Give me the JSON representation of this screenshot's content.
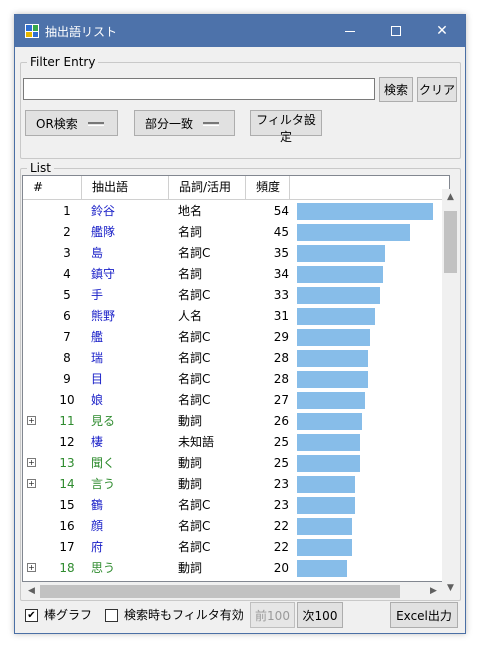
{
  "window": {
    "title": "抽出語リスト",
    "minimize": "—",
    "maximize": "□",
    "close": "✕"
  },
  "filter": {
    "legend": "Filter Entry",
    "search_value": "",
    "search_button": "検索",
    "clear_button": "クリア",
    "search_mode": "OR検索",
    "match_mode": "部分一致",
    "filter_settings": "フィルタ設定"
  },
  "list": {
    "legend": "List",
    "columns": [
      "#",
      "抽出語",
      "品詞/活用",
      "頻度"
    ],
    "max_freq": 54,
    "rows": [
      {
        "num": "1",
        "word": "鈴谷",
        "pos": "地名",
        "freq": 54,
        "expandable": false
      },
      {
        "num": "2",
        "word": "艦隊",
        "pos": "名詞",
        "freq": 45,
        "expandable": false
      },
      {
        "num": "3",
        "word": "島",
        "pos": "名詞C",
        "freq": 35,
        "expandable": false
      },
      {
        "num": "4",
        "word": "鎮守",
        "pos": "名詞",
        "freq": 34,
        "expandable": false
      },
      {
        "num": "5",
        "word": "手",
        "pos": "名詞C",
        "freq": 33,
        "expandable": false
      },
      {
        "num": "6",
        "word": "熊野",
        "pos": "人名",
        "freq": 31,
        "expandable": false
      },
      {
        "num": "7",
        "word": "艦",
        "pos": "名詞C",
        "freq": 29,
        "expandable": false
      },
      {
        "num": "8",
        "word": "瑞",
        "pos": "名詞C",
        "freq": 28,
        "expandable": false
      },
      {
        "num": "9",
        "word": "目",
        "pos": "名詞C",
        "freq": 28,
        "expandable": false
      },
      {
        "num": "10",
        "word": "娘",
        "pos": "名詞C",
        "freq": 27,
        "expandable": false
      },
      {
        "num": "11",
        "word": "見る",
        "pos": "動詞",
        "freq": 26,
        "expandable": true
      },
      {
        "num": "12",
        "word": "棲",
        "pos": "未知語",
        "freq": 25,
        "expandable": false
      },
      {
        "num": "13",
        "word": "聞く",
        "pos": "動詞",
        "freq": 25,
        "expandable": true
      },
      {
        "num": "14",
        "word": "言う",
        "pos": "動詞",
        "freq": 23,
        "expandable": true
      },
      {
        "num": "15",
        "word": "鶴",
        "pos": "名詞C",
        "freq": 23,
        "expandable": false
      },
      {
        "num": "16",
        "word": "顔",
        "pos": "名詞C",
        "freq": 22,
        "expandable": false
      },
      {
        "num": "17",
        "word": "府",
        "pos": "名詞C",
        "freq": 22,
        "expandable": false
      },
      {
        "num": "18",
        "word": "思う",
        "pos": "動詞",
        "freq": 20,
        "expandable": true
      }
    ]
  },
  "footer": {
    "bar_graph_label": "棒グラフ",
    "bar_graph_checked": true,
    "filter_on_search_label": "検索時もフィルタ有効",
    "filter_on_search_checked": false,
    "prev_button": "前100",
    "next_button": "次100",
    "excel_button": "Excel出力"
  },
  "colors": {
    "titlebar": "#4d72aa",
    "bar": "#87bde9",
    "word_link": "#1a20c8",
    "expandable_green": "#2e8b2e"
  }
}
